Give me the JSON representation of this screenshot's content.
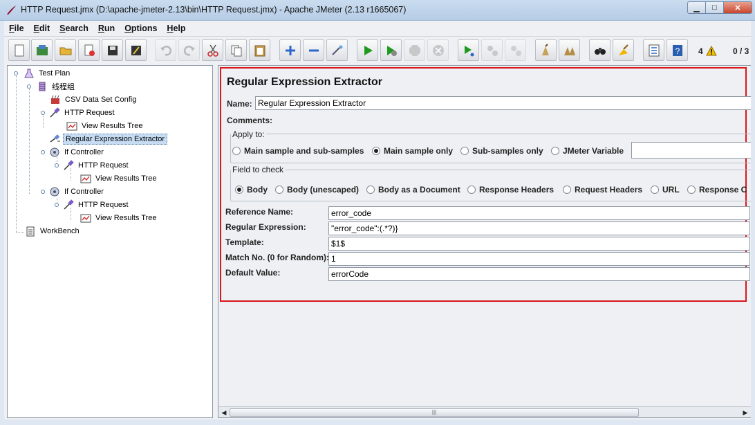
{
  "window": {
    "title": "HTTP Request.jmx (D:\\apache-jmeter-2.13\\bin\\HTTP Request.jmx) - Apache JMeter (2.13 r1665067)",
    "minimize": "▁",
    "maximize": "□",
    "close": "✕"
  },
  "menu": [
    "File",
    "Edit",
    "Search",
    "Run",
    "Options",
    "Help"
  ],
  "toolbar": {
    "warning_count": "4",
    "thread_count": "0 / 3"
  },
  "tree": {
    "test_plan": "Test Plan",
    "thread_group": "线程组",
    "csv": "CSV Data Set Config",
    "http1": "HTTP Request",
    "vrt1": "View Results Tree",
    "regex": "Regular Expression Extractor",
    "if1": "If Controller",
    "http2": "HTTP Request",
    "vrt2": "View Results Tree",
    "if2": "If Controller",
    "http3": "HTTP Request",
    "vrt3": "View Results Tree",
    "workbench": "WorkBench"
  },
  "editor": {
    "title": "Regular Expression Extractor",
    "name_label": "Name:",
    "name_value": "Regular Expression Extractor",
    "comments_label": "Comments:",
    "apply_to": {
      "title": "Apply to:",
      "options": [
        "Main sample and sub-samples",
        "Main sample only",
        "Sub-samples only",
        "JMeter Variable"
      ],
      "selected": 1
    },
    "field_to_check": {
      "title": "Field to check",
      "options": [
        "Body",
        "Body (unescaped)",
        "Body as a Document",
        "Response Headers",
        "Request Headers",
        "URL",
        "Response C"
      ],
      "selected": 0
    },
    "fields": [
      {
        "label": "Reference Name:",
        "value": "error_code"
      },
      {
        "label": "Regular Expression:",
        "value": "\"error_code\":(.*?)}"
      },
      {
        "label": "Template:",
        "value": "$1$"
      },
      {
        "label": "Match No. (0 for Random):",
        "value": "1"
      },
      {
        "label": "Default Value:",
        "value": "errorCode"
      }
    ]
  },
  "colors": {
    "highlight_border": "#d9161b",
    "selection": "#c6dcf3"
  }
}
